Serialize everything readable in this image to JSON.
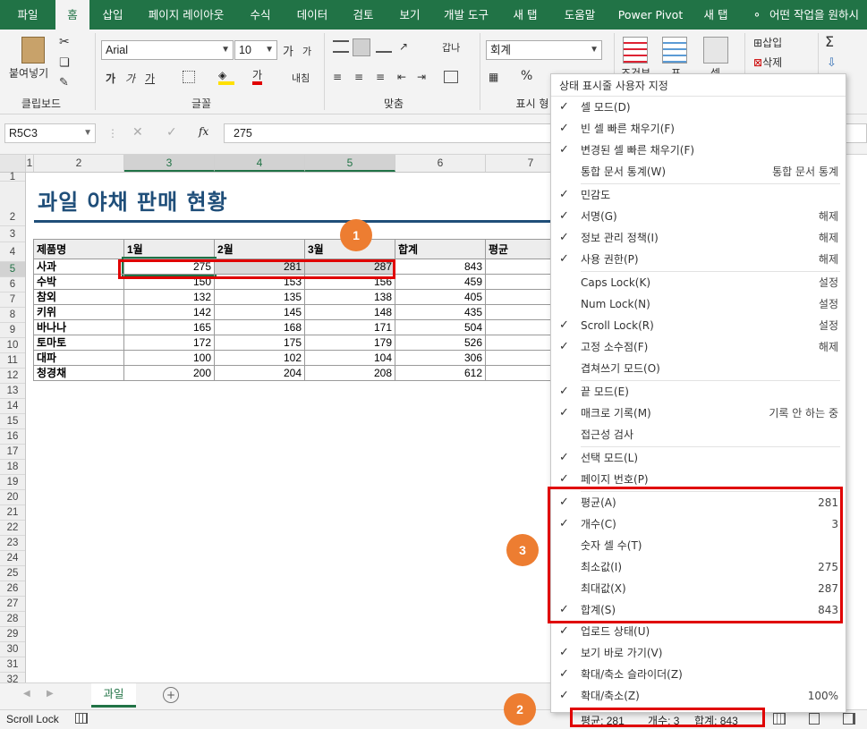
{
  "ribbon_tabs": [
    "파일",
    "홈",
    "삽입",
    "페이지 레이아웃",
    "수식",
    "데이터",
    "검토",
    "보기",
    "개발 도구",
    "새 탭",
    "도움말",
    "Power Pivot",
    "새 탭",
    "어떤 작업을 원하시"
  ],
  "ribbon": {
    "paste_label": "붙여넣기",
    "clipboard_group": "클립보드",
    "font_group": "글꼴",
    "align_group": "맞춤",
    "number_group": "표시 형",
    "font_name": "Arial",
    "font_size": "10",
    "number_format": "회계",
    "insert_label": "삽입",
    "delete_label": "삭제",
    "cond_label": "조건부",
    "table_label": "표",
    "cell_label": "셀",
    "wrap_label": "갑나",
    "merge_label": "내침",
    "percent": "%",
    "bold": "가",
    "italic": "가",
    "underline": "가",
    "grow": "가",
    "shrink": "가",
    "font_color": "가"
  },
  "formula_bar": {
    "name_box": "R5C3",
    "formula": "275",
    "fx": "fx"
  },
  "column_headers": [
    "1",
    "2",
    "3",
    "4",
    "5",
    "6",
    "7"
  ],
  "row_headers": [
    "1",
    "2",
    "3",
    "4",
    "5",
    "6",
    "7",
    "8",
    "9",
    "10",
    "11",
    "12",
    "13",
    "14",
    "15",
    "16",
    "17",
    "18",
    "19",
    "20",
    "21",
    "22",
    "23",
    "24",
    "25",
    "26",
    "27",
    "28",
    "29",
    "30",
    "31",
    "32"
  ],
  "sheet": {
    "title": "과일 야채 판매 현황",
    "headers": [
      "제품명",
      "1월",
      "2월",
      "3월",
      "합계",
      "평균"
    ],
    "rows": [
      [
        "사과",
        "275",
        "281",
        "287",
        "843"
      ],
      [
        "수박",
        "150",
        "153",
        "156",
        "459"
      ],
      [
        "참외",
        "132",
        "135",
        "138",
        "405"
      ],
      [
        "키위",
        "142",
        "145",
        "148",
        "435"
      ],
      [
        "바나나",
        "165",
        "168",
        "171",
        "504"
      ],
      [
        "토마토",
        "172",
        "175",
        "179",
        "526"
      ],
      [
        "대파",
        "100",
        "102",
        "104",
        "306"
      ],
      [
        "청경채",
        "200",
        "204",
        "208",
        "612"
      ]
    ]
  },
  "sheet_tab": "과일",
  "status_mode": "Scroll Lock",
  "status_summary": {
    "avg": "평균:  281",
    "count": "개수: 3",
    "sum": "합계:  843"
  },
  "menu": {
    "title": "상태 표시줄 사용자 지정",
    "items": [
      {
        "label": "셀 모드(D)",
        "value": "",
        "checked": "✓"
      },
      {
        "label": "빈 셀 빠른 채우기(F)",
        "value": "",
        "checked": "✓"
      },
      {
        "label": "변경된 셀 빠른 채우기(F)",
        "value": "",
        "checked": "✓"
      },
      {
        "label": "통합 문서 통계(W)",
        "value": "통합 문서 통계",
        "checked": ""
      },
      {
        "label": "민감도",
        "value": "",
        "checked": "✓"
      },
      {
        "label": "서명(G)",
        "value": "해제",
        "checked": "✓"
      },
      {
        "label": "정보 관리 정책(I)",
        "value": "해제",
        "checked": "✓"
      },
      {
        "label": "사용 권한(P)",
        "value": "해제",
        "checked": "✓"
      },
      {
        "label": "Caps Lock(K)",
        "value": "설정",
        "checked": ""
      },
      {
        "label": "Num Lock(N)",
        "value": "설정",
        "checked": ""
      },
      {
        "label": "Scroll Lock(R)",
        "value": "설정",
        "checked": "✓"
      },
      {
        "label": "고정 소수점(F)",
        "value": "해제",
        "checked": "✓"
      },
      {
        "label": "겹쳐쓰기 모드(O)",
        "value": "",
        "checked": ""
      },
      {
        "label": "끝 모드(E)",
        "value": "",
        "checked": "✓"
      },
      {
        "label": "매크로 기록(M)",
        "value": "기록 안 하는 중",
        "checked": "✓"
      },
      {
        "label": "접근성 검사",
        "value": "",
        "checked": ""
      },
      {
        "label": "선택 모드(L)",
        "value": "",
        "checked": "✓"
      },
      {
        "label": "페이지 번호(P)",
        "value": "",
        "checked": "✓"
      },
      {
        "label": "평균(A)",
        "value": "281",
        "checked": "✓"
      },
      {
        "label": "개수(C)",
        "value": "3",
        "checked": "✓"
      },
      {
        "label": "숫자 셀 수(T)",
        "value": "",
        "checked": ""
      },
      {
        "label": "최소값(I)",
        "value": "275",
        "checked": ""
      },
      {
        "label": "최대값(X)",
        "value": "287",
        "checked": ""
      },
      {
        "label": "합계(S)",
        "value": "843",
        "checked": "✓"
      },
      {
        "label": "업로드 상태(U)",
        "value": "",
        "checked": "✓"
      },
      {
        "label": "보기 바로 가기(V)",
        "value": "",
        "checked": "✓"
      },
      {
        "label": "확대/축소 슬라이더(Z)",
        "value": "",
        "checked": "✓"
      },
      {
        "label": "확대/축소(Z)",
        "value": "100%",
        "checked": "✓"
      }
    ]
  },
  "badges": [
    "1",
    "2",
    "3"
  ],
  "colors": {
    "excel_green": "#217346",
    "title_blue": "#1f4e79",
    "badge": "#ed7d31",
    "highlight": "#e00000"
  }
}
